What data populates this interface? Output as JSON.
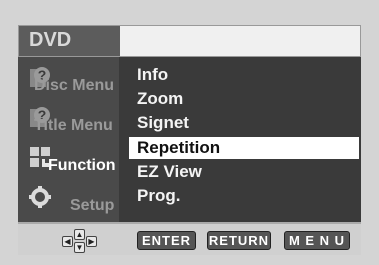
{
  "header": {
    "title": "DVD"
  },
  "sidebar": {
    "items": [
      {
        "label": "Disc Menu",
        "icon": "disc-menu-icon",
        "active": false
      },
      {
        "label": "Title Menu",
        "icon": "title-menu-icon",
        "active": false
      },
      {
        "label": "Function",
        "icon": "function-icon",
        "active": true
      },
      {
        "label": "Setup",
        "icon": "gear-icon",
        "active": false
      }
    ]
  },
  "menu": {
    "items": [
      {
        "label": "Info",
        "selected": false
      },
      {
        "label": "Zoom",
        "selected": false
      },
      {
        "label": "Signet",
        "selected": false
      },
      {
        "label": "Repetition",
        "selected": true
      },
      {
        "label": "EZ View",
        "selected": false
      },
      {
        "label": "Prog.",
        "selected": false
      }
    ]
  },
  "footer": {
    "enter_label": "ENTER",
    "return_label": "RETURN",
    "menu_label": "M E N U"
  }
}
